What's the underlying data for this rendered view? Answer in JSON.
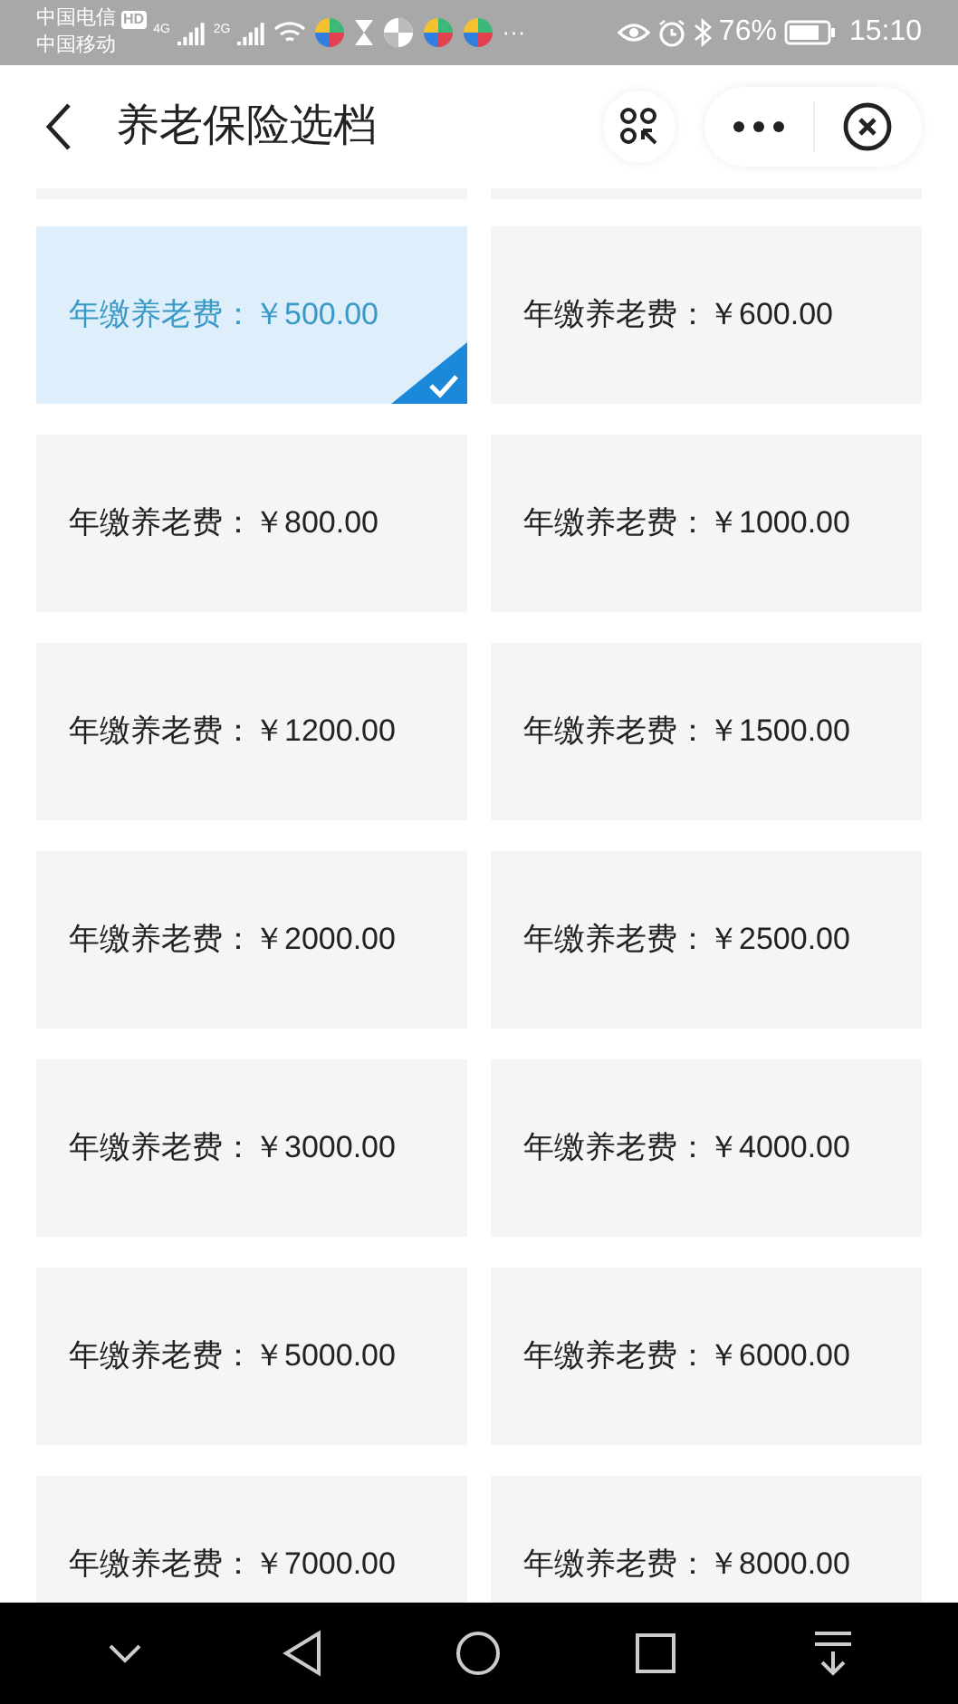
{
  "status_bar": {
    "carrier_1": "中国电信",
    "hd_badge": "HD",
    "network_1": "4G",
    "carrier_2": "中国移动",
    "network_2": "2G",
    "more": "···",
    "battery_text": "76%",
    "time": "15:10"
  },
  "header": {
    "title": "养老保险选档"
  },
  "options": [
    {
      "label": "年缴养老费：￥500.00",
      "selected": true
    },
    {
      "label": "年缴养老费：￥600.00",
      "selected": false
    },
    {
      "label": "年缴养老费：￥800.00",
      "selected": false
    },
    {
      "label": "年缴养老费：￥1000.00",
      "selected": false
    },
    {
      "label": "年缴养老费：￥1200.00",
      "selected": false
    },
    {
      "label": "年缴养老费：￥1500.00",
      "selected": false
    },
    {
      "label": "年缴养老费：￥2000.00",
      "selected": false
    },
    {
      "label": "年缴养老费：￥2500.00",
      "selected": false
    },
    {
      "label": "年缴养老费：￥3000.00",
      "selected": false
    },
    {
      "label": "年缴养老费：￥4000.00",
      "selected": false
    },
    {
      "label": "年缴养老费：￥5000.00",
      "selected": false
    },
    {
      "label": "年缴养老费：￥6000.00",
      "selected": false
    },
    {
      "label": "年缴养老费：￥7000.00",
      "selected": false
    },
    {
      "label": "年缴养老费：￥8000.00",
      "selected": false
    }
  ]
}
